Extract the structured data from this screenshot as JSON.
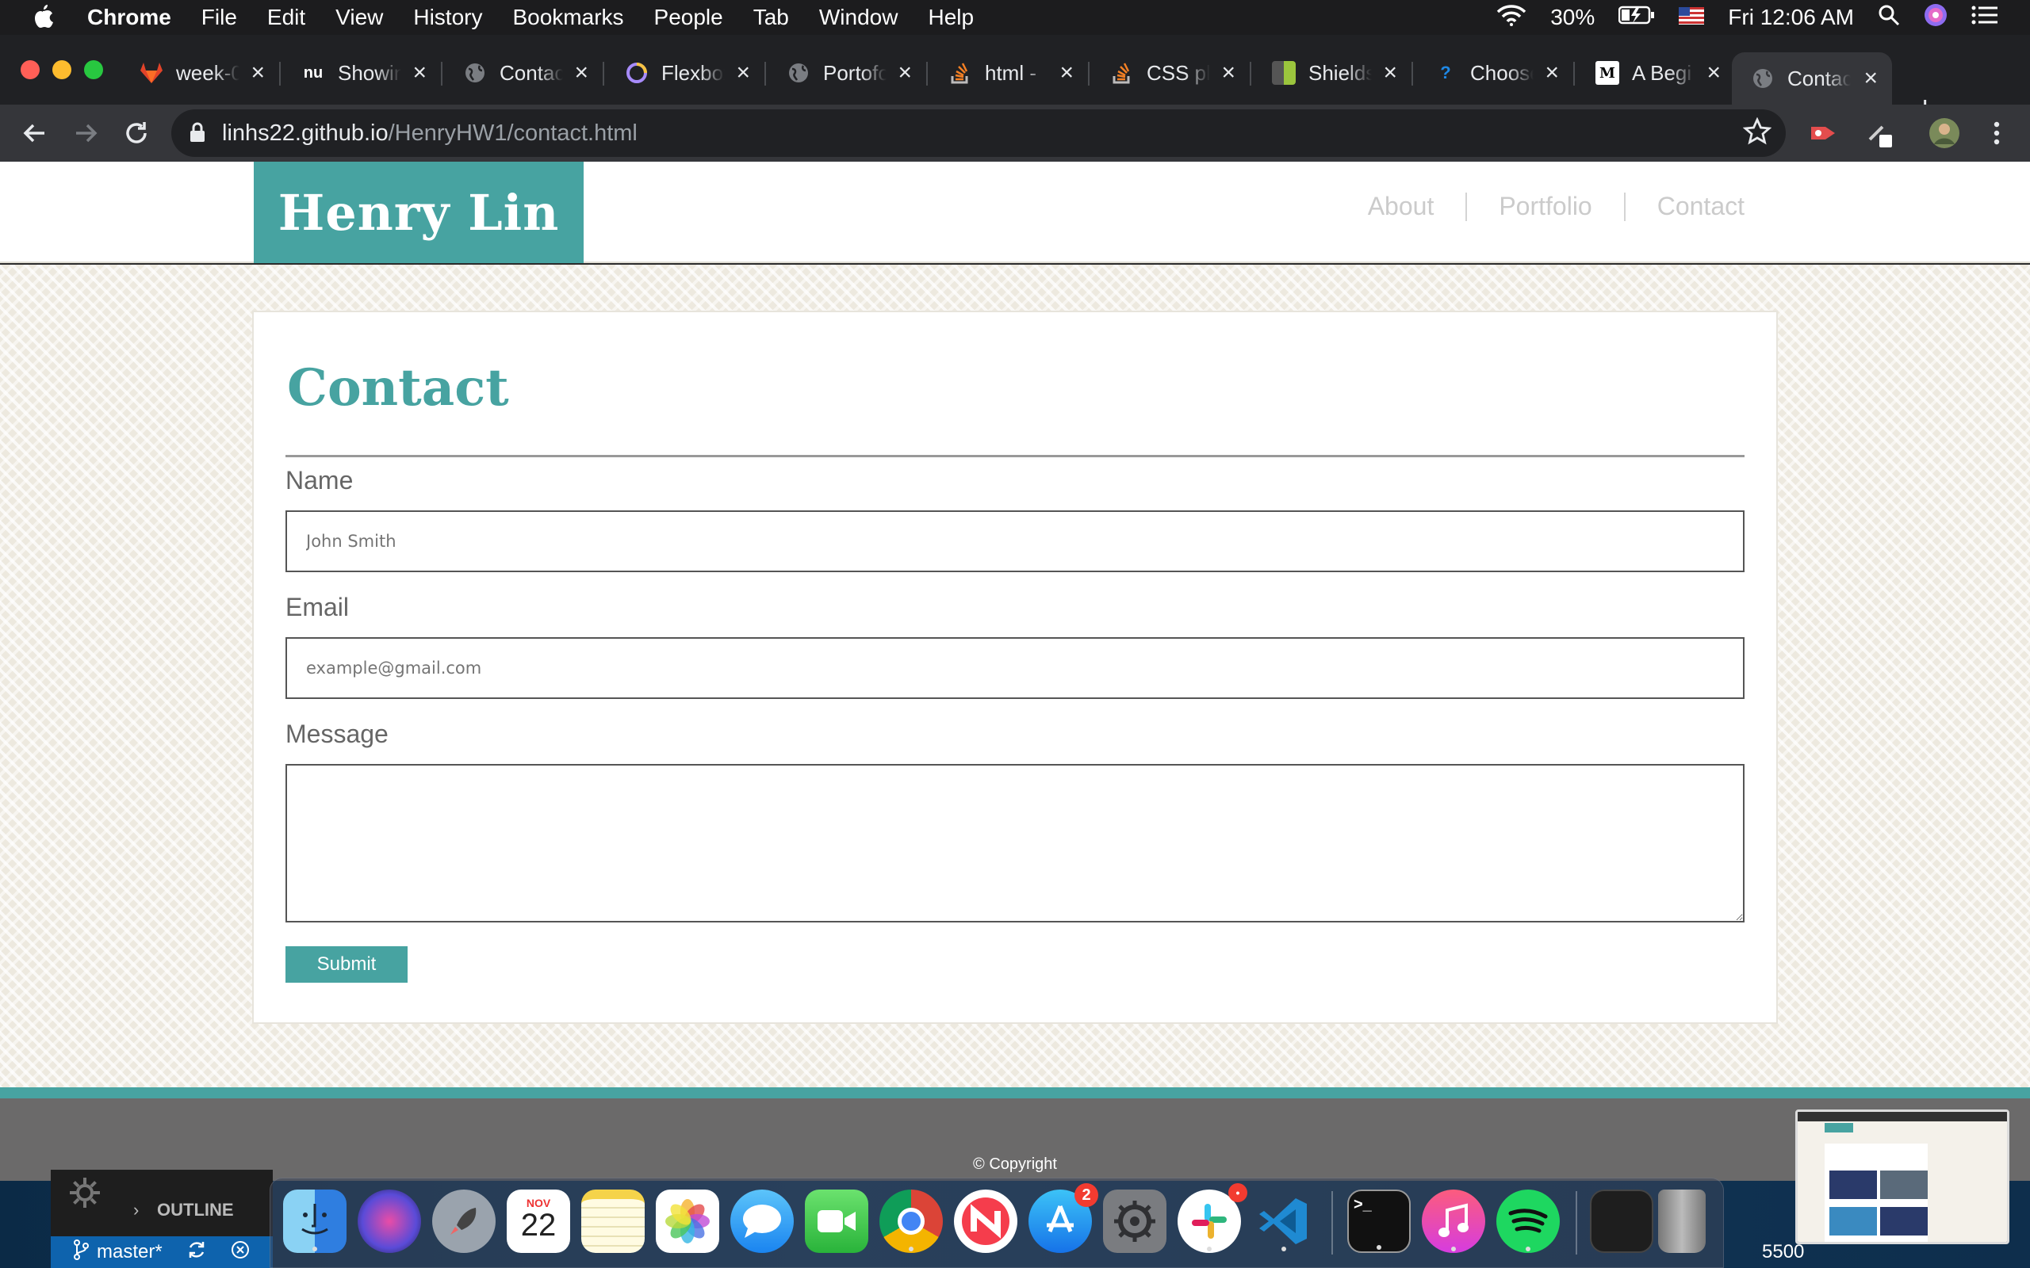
{
  "menubar": {
    "app": "Chrome",
    "items": [
      "File",
      "Edit",
      "View",
      "History",
      "Bookmarks",
      "People",
      "Tab",
      "Window",
      "Help"
    ],
    "battery": "30%",
    "clock": "Fri 12:06 AM"
  },
  "tabs": [
    {
      "label": "week-0",
      "icon": "gitlab-icon",
      "color": "#e24329"
    },
    {
      "label": "Showing",
      "icon": "nu-icon",
      "color": "#ffffff"
    },
    {
      "label": "Contact",
      "icon": "globe-icon",
      "color": "#9aa0a6"
    },
    {
      "label": "Flexbox",
      "icon": "flexbox-icon",
      "color": "#a78bfa"
    },
    {
      "label": "Portofolio",
      "icon": "globe-icon",
      "color": "#9aa0a6"
    },
    {
      "label": "html -",
      "icon": "stackoverflow-icon",
      "color": "#f48024"
    },
    {
      "label": "CSS pl",
      "icon": "stackoverflow-icon",
      "color": "#f48024"
    },
    {
      "label": "Shields",
      "icon": "shield-icon",
      "color": "#9bc53d"
    },
    {
      "label": "Choose",
      "icon": "question-icon",
      "color": "#1e88e5"
    },
    {
      "label": "A Begi",
      "icon": "medium-icon",
      "color": "#ffffff"
    },
    {
      "label": "Contact",
      "icon": "globe-icon",
      "color": "#9aa0a6",
      "active": true
    }
  ],
  "address": {
    "host": "linhs22.github.io",
    "path": "/HenryHW1/contact.html"
  },
  "site": {
    "brand": "Henry Lin",
    "nav": [
      "About",
      "Portfolio",
      "Contact"
    ],
    "accent": "#47a3a1"
  },
  "form": {
    "heading": "Contact",
    "name_label": "Name",
    "name_placeholder": "John Smith",
    "email_label": "Email",
    "email_placeholder": "example@gmail.com",
    "message_label": "Message",
    "submit_label": "Submit"
  },
  "footer": {
    "copyright": "© Copyright"
  },
  "vscode": {
    "outline_label": "OUTLINE",
    "branch": "master*",
    "port": "5500"
  },
  "dock": {
    "calendar_month": "NOV",
    "calendar_day": "22",
    "appstore_badge": "2"
  }
}
